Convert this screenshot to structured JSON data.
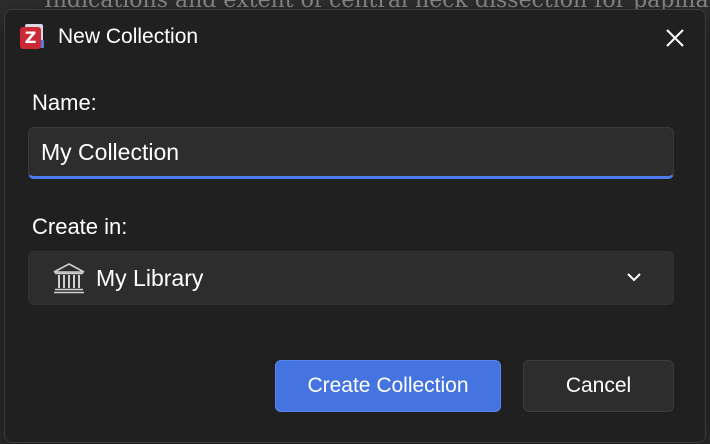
{
  "background": {
    "text": "Indications and extent of central neck dissection for papillar"
  },
  "dialog": {
    "title": "New Collection",
    "app_icon_letter": "Z",
    "name_label": "Name:",
    "name_value": "My Collection",
    "create_in_label": "Create in:",
    "create_in_value": "My Library",
    "create_button": "Create Collection",
    "cancel_button": "Cancel"
  },
  "icons": {
    "app": "zotero-app-icon",
    "close": "close-icon",
    "library": "library-icon",
    "chevron": "chevron-down-icon"
  },
  "colors": {
    "accent": "#4573e0",
    "dialog_bg": "#202020",
    "field_bg": "#2d2d2d"
  }
}
